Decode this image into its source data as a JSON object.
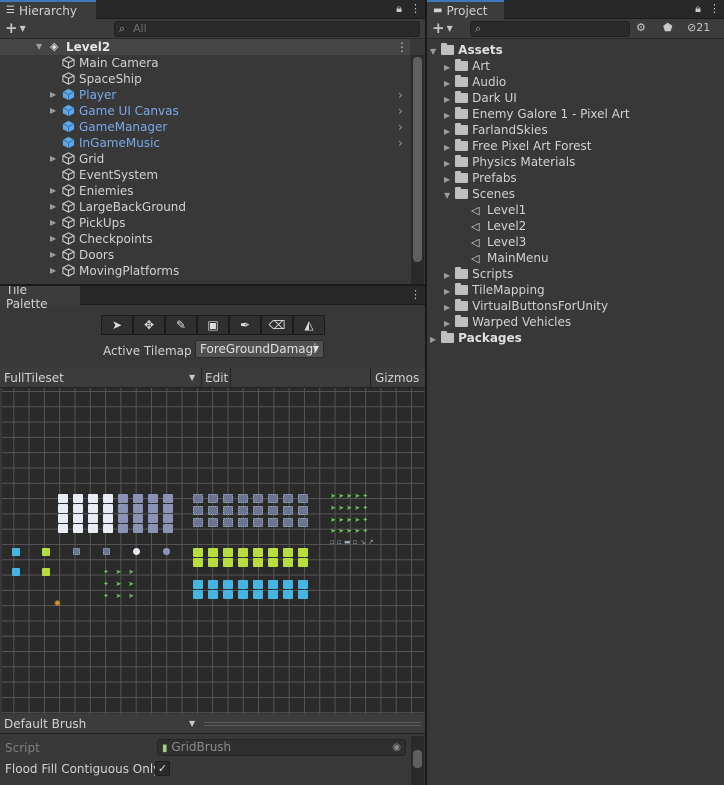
{
  "hierarchy": {
    "tab_title": "Hierarchy",
    "search_placeholder": "All",
    "scene_name": "Level2",
    "items": [
      {
        "label": "Main Camera",
        "kind": "plain"
      },
      {
        "label": "SpaceShip",
        "kind": "plain"
      },
      {
        "label": "Player",
        "kind": "prefab",
        "expandable": true
      },
      {
        "label": "Game UI Canvas",
        "kind": "prefab",
        "expandable": true
      },
      {
        "label": "GameManager",
        "kind": "prefab",
        "expandable": false
      },
      {
        "label": "InGameMusic",
        "kind": "prefab",
        "expandable": false
      },
      {
        "label": "Grid",
        "kind": "plain",
        "expandable": true
      },
      {
        "label": "EventSystem",
        "kind": "plain"
      },
      {
        "label": "Eniemies",
        "kind": "plain",
        "expandable": true
      },
      {
        "label": "LargeBackGround",
        "kind": "plain",
        "expandable": true
      },
      {
        "label": "PickUps",
        "kind": "plain",
        "expandable": true
      },
      {
        "label": "Checkpoints",
        "kind": "plain",
        "expandable": true
      },
      {
        "label": "Doors",
        "kind": "plain",
        "expandable": true
      },
      {
        "label": "MovingPlatforms",
        "kind": "plain",
        "expandable": true
      }
    ]
  },
  "tile_palette": {
    "tab_title": "Tile Palette",
    "tools": [
      "select-tool",
      "move-tool",
      "paint-brush-tool",
      "box-fill-tool",
      "picker-tool",
      "eraser-tool",
      "flood-fill-tool"
    ],
    "active_tilemap_label": "Active Tilemap",
    "active_tilemap_value": "ForeGroundDamagi",
    "palette_name": "FullTileset",
    "edit_label": "Edit",
    "gizmos_label": "Gizmos",
    "brush_name": "Default Brush",
    "script_label": "Script",
    "script_value": "GridBrush",
    "flood_fill_label": "Flood Fill Contiguous Only",
    "flood_fill_checked": true
  },
  "project": {
    "tab_title": "Project",
    "hidden_count": "21",
    "root": "Assets",
    "folders": [
      "Art",
      "Audio",
      "Dark UI",
      "Enemy Galore 1 - Pixel Art",
      "FarlandSkies",
      "Free Pixel Art Forest",
      "Physics Materials",
      "Prefabs"
    ],
    "scenes_folder": "Scenes",
    "scenes": [
      "Level1",
      "Level2",
      "Level3",
      "MainMenu"
    ],
    "folders_after": [
      "Scripts",
      "TileMapping",
      "VirtualButtonsForUnity",
      "Warped Vehicles"
    ],
    "packages": "Packages"
  },
  "colors": {
    "panel_bg": "#383838",
    "accent_tab": "#3a79bb",
    "prefab_text": "#7aa9e9",
    "yellow_tile": "#b6df3e",
    "cyan_tile": "#46b6e0"
  }
}
